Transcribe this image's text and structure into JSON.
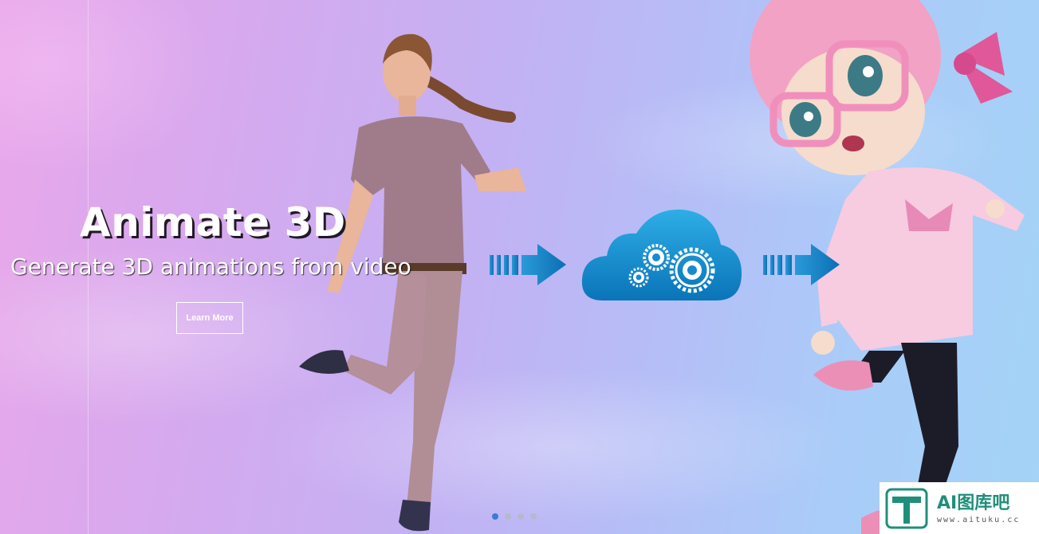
{
  "hero": {
    "title": "Animate 3D",
    "subtitle": "Generate 3D animations from video",
    "cta_label": "Learn More"
  },
  "flow": {
    "icons": [
      "arrow-right-icon",
      "cloud-gears-icon",
      "arrow-right-icon"
    ]
  },
  "carousel": {
    "slide_count": 4,
    "active_index": 0
  },
  "watermark": {
    "logo_letter": "T",
    "text": "AI图库吧",
    "sub": "www.aituku.cc"
  },
  "colors": {
    "accent_blue": "#1a8ad0",
    "dot_active": "#3a7bd5",
    "watermark_green": "#1f8f7a"
  }
}
